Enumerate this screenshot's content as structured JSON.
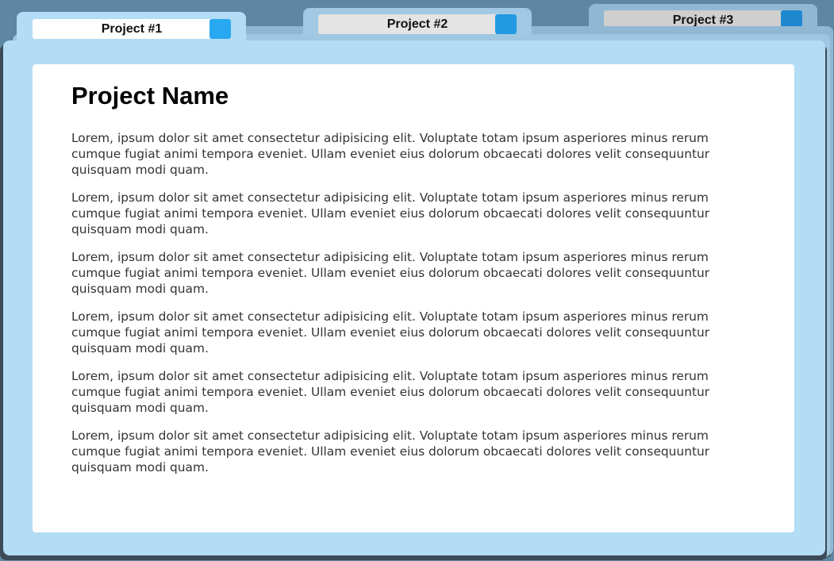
{
  "tabs": [
    {
      "label": "Project #1",
      "active": true,
      "box_color": "#ffffff",
      "button_color": "#28a8f0"
    },
    {
      "label": "Project #2",
      "active": false,
      "box_color": "#e4e4e4",
      "button_color": "#2299e2"
    },
    {
      "label": "Project #3",
      "active": false,
      "box_color": "#cfcfcf",
      "button_color": "#1e88cf"
    }
  ],
  "content": {
    "title": "Project Name",
    "paragraphs": [
      "Lorem, ipsum dolor sit amet consectetur adipisicing elit. Voluptate totam ipsum asperiores minus rerum cumque fugiat animi tempora eveniet. Ullam eveniet eius dolorum obcaecati dolores velit consequuntur quisquam modi quam.",
      "Lorem, ipsum dolor sit amet consectetur adipisicing elit. Voluptate totam ipsum asperiores minus rerum cumque fugiat animi tempora eveniet. Ullam eveniet eius dolorum obcaecati dolores velit consequuntur quisquam modi quam.",
      "Lorem, ipsum dolor sit amet consectetur adipisicing elit. Voluptate totam ipsum asperiores minus rerum cumque fugiat animi tempora eveniet. Ullam eveniet eius dolorum obcaecati dolores velit consequuntur quisquam modi quam.",
      "Lorem, ipsum dolor sit amet consectetur adipisicing elit. Voluptate totam ipsum asperiores minus rerum cumque fugiat animi tempora eveniet. Ullam eveniet eius dolorum obcaecati dolores velit consequuntur quisquam modi quam.",
      "Lorem, ipsum dolor sit amet consectetur adipisicing elit. Voluptate totam ipsum asperiores minus rerum cumque fugiat animi tempora eveniet. Ullam eveniet eius dolorum obcaecati dolores velit consequuntur quisquam modi quam.",
      "Lorem, ipsum dolor sit amet consectetur adipisicing elit. Voluptate totam ipsum asperiores minus rerum cumque fugiat animi tempora eveniet. Ullam eveniet eius dolorum obcaecati dolores velit consequuntur quisquam modi quam."
    ]
  },
  "colors": {
    "background": "#5d86a3",
    "folder_front": "#b3dcf5",
    "folder_mid": "#9fc7e2",
    "folder_back": "#90b8d3",
    "panel": "#ffffff"
  }
}
